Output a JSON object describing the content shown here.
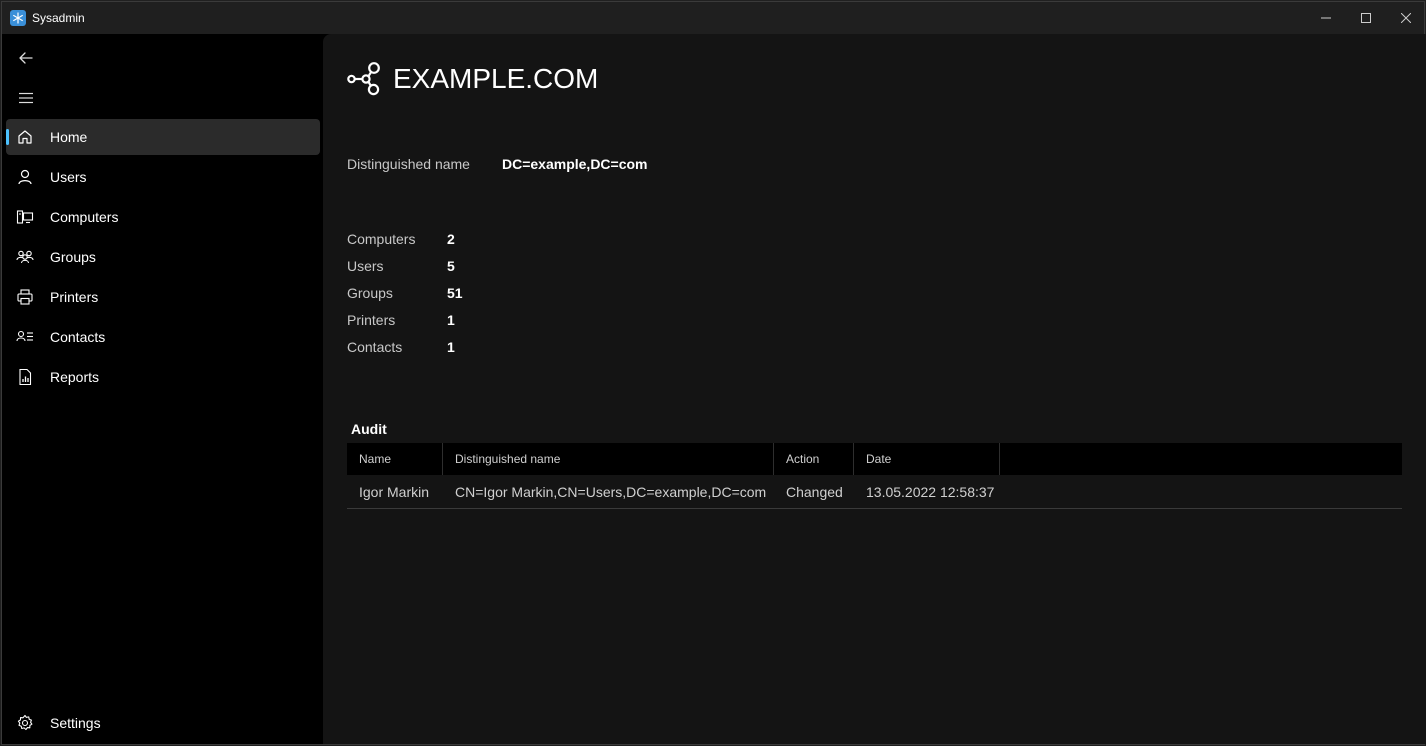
{
  "window": {
    "title": "Sysadmin",
    "icon": "app-snowflake-icon",
    "controls": [
      "minimize-icon",
      "maximize-icon",
      "close-icon"
    ]
  },
  "sidebar": {
    "back_icon": "back-arrow-icon",
    "menu_icon": "hamburger-menu-icon",
    "items": [
      {
        "label": "Home",
        "icon": "home-icon",
        "active": true
      },
      {
        "label": "Users",
        "icon": "user-icon",
        "active": false
      },
      {
        "label": "Computers",
        "icon": "computer-icon",
        "active": false
      },
      {
        "label": "Groups",
        "icon": "groups-icon",
        "active": false
      },
      {
        "label": "Printers",
        "icon": "printer-icon",
        "active": false
      },
      {
        "label": "Contacts",
        "icon": "contacts-icon",
        "active": false
      },
      {
        "label": "Reports",
        "icon": "reports-icon",
        "active": false
      }
    ],
    "settings": {
      "label": "Settings",
      "icon": "gear-icon"
    }
  },
  "main": {
    "title": "EXAMPLE.COM",
    "title_icon": "domain-nodes-icon",
    "distinguished_name_label": "Distinguished name",
    "distinguished_name_value": "DC=example,DC=com",
    "stats": [
      {
        "label": "Computers",
        "value": "2"
      },
      {
        "label": "Users",
        "value": "5"
      },
      {
        "label": "Groups",
        "value": "51"
      },
      {
        "label": "Printers",
        "value": "1"
      },
      {
        "label": "Contacts",
        "value": "1"
      }
    ],
    "audit": {
      "title": "Audit",
      "columns": [
        "Name",
        "Distinguished name",
        "Action",
        "Date"
      ],
      "rows": [
        {
          "name": "Igor Markin",
          "dn": "CN=Igor Markin,CN=Users,DC=example,DC=com",
          "action": "Changed",
          "date": "13.05.2022 12:58:37"
        }
      ]
    }
  },
  "colors": {
    "accent": "#4cc2ff",
    "sidebar_bg": "#000000",
    "content_bg": "#141414",
    "active_item_bg": "#2b2b2b"
  }
}
